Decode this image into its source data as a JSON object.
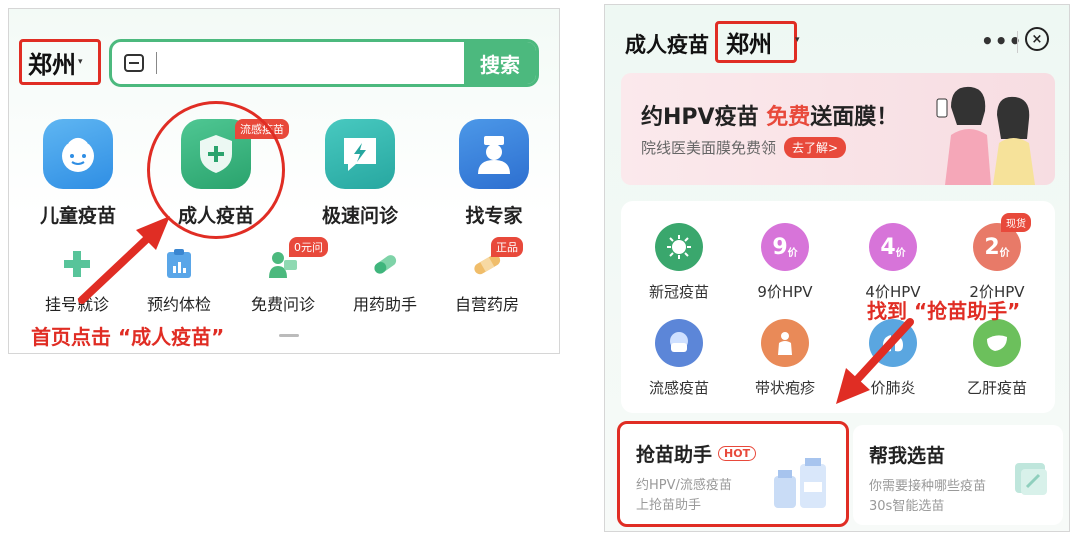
{
  "left": {
    "location": "郑州",
    "search_button": "搜索",
    "search_placeholder": "",
    "big_items": [
      {
        "label": "儿童疫苗",
        "icon": "child-face-icon"
      },
      {
        "label": "成人疫苗",
        "icon": "shield-plus-icon",
        "badge": "流感疫苗"
      },
      {
        "label": "极速问诊",
        "icon": "lightning-chat-icon"
      },
      {
        "label": "找专家",
        "icon": "doctor-icon"
      }
    ],
    "small_items": [
      {
        "label": "挂号就诊",
        "icon": "medical-cross-icon"
      },
      {
        "label": "预约体检",
        "icon": "clipboard-chart-icon"
      },
      {
        "label": "免费问诊",
        "icon": "doctor-chat-icon",
        "badge": "0元问"
      },
      {
        "label": "用药助手",
        "icon": "pill-icon"
      },
      {
        "label": "自营药房",
        "icon": "bandage-icon",
        "badge": "正品"
      }
    ],
    "caption": "首页点击 “成人疫苗”"
  },
  "right": {
    "title": "成人疫苗",
    "location": "郑州",
    "more": "•••",
    "close": "×",
    "banner": {
      "title_pre": "约HPV疫苗 ",
      "title_highlight": "免费",
      "title_post": "送面膜！",
      "subtitle": "院线医美面膜免费领",
      "button": "去了解>"
    },
    "grid": [
      {
        "label": "新冠疫苗",
        "icon": "virus-icon",
        "color": "#3aa76d"
      },
      {
        "label": "9价HPV",
        "icon_text": "9",
        "icon_sub": "价",
        "color": "#d774d9"
      },
      {
        "label": "4价HPV",
        "icon_text": "4",
        "icon_sub": "价",
        "color": "#d774d9"
      },
      {
        "label": "2价HPV",
        "icon_text": "2",
        "icon_sub": "价",
        "color": "#e87a68",
        "badge": "现货"
      },
      {
        "label": "流感疫苗",
        "icon": "mask-face-icon",
        "color": "#5c86d8"
      },
      {
        "label": "带状疱疹",
        "icon": "body-icon",
        "color": "#e98a58"
      },
      {
        "label": "价肺炎",
        "icon": "lungs-icon",
        "color": "#5aa6e0"
      },
      {
        "label": "乙肝疫苗",
        "icon": "liver-icon",
        "color": "#6cc05c"
      }
    ],
    "caption": "找到 “抢苗助手”",
    "cards": [
      {
        "title": "抢苗助手",
        "tag": "HOT",
        "sub_lines": [
          "约HPV/流感疫苗",
          "上抢苗助手"
        ]
      },
      {
        "title": "帮我选苗",
        "sub_lines": [
          "你需要接种哪些疫苗",
          "30s智能选苗"
        ]
      }
    ]
  },
  "colors": {
    "accent_green": "#4cb97e",
    "highlight_red": "#e02d24",
    "badge_red": "#e8493b"
  }
}
